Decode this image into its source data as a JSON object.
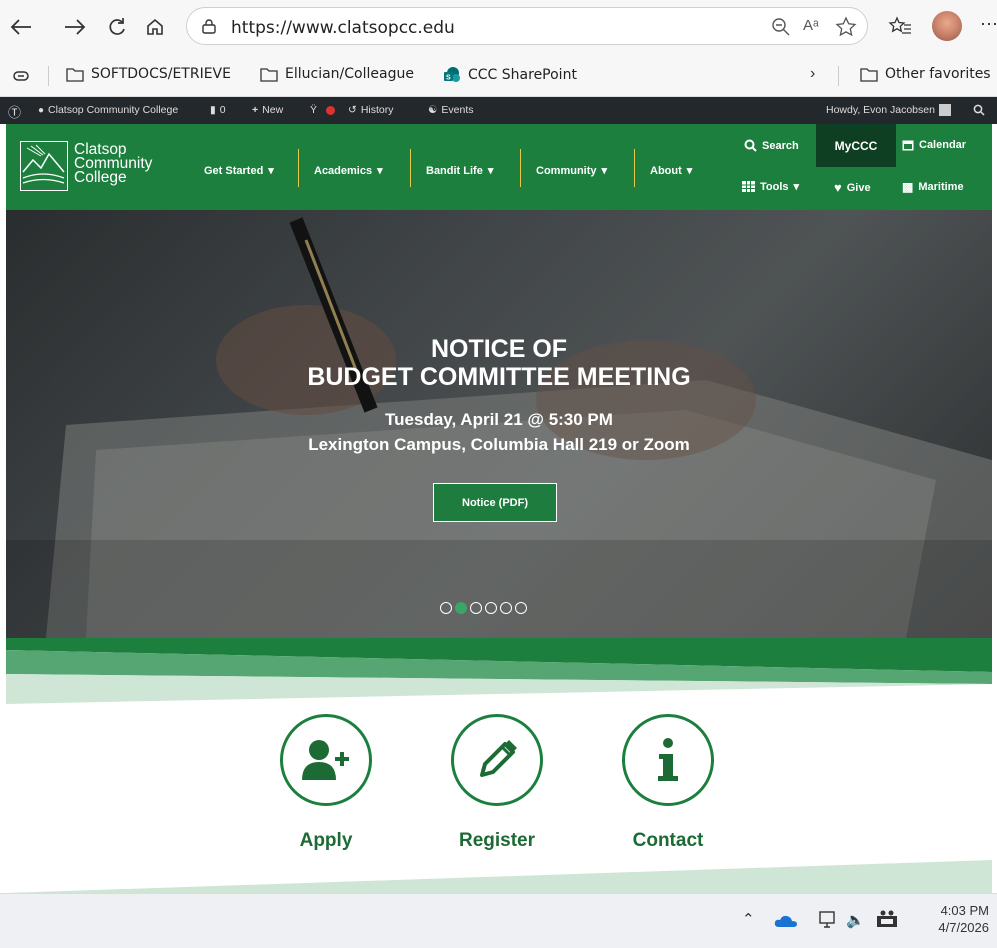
{
  "browser": {
    "url": "https://www.clatsopcc.edu",
    "bookmarks": [
      "SOFTDOCS/ETRIEVE",
      "Ellucian/Colleague",
      "CCC SharePoint"
    ],
    "other_favorites": "Other favorites"
  },
  "adminbar": {
    "site_name": "Clatsop Community College",
    "comments": "0",
    "new_label": "New",
    "history_label": "History",
    "events_label": "Events",
    "howdy": "Howdy, Evon Jacobsen"
  },
  "header": {
    "logo_lines": [
      "Clatsop",
      "Community",
      "College"
    ],
    "menu": [
      "Get Started",
      "Academics",
      "Bandit Life",
      "Community",
      "About"
    ],
    "search_label": "Search",
    "myccc_label": "MyCCC",
    "calendar_label": "Calendar",
    "tools_label": "Tools",
    "give_label": "Give",
    "maritime_label": "Maritime"
  },
  "hero": {
    "title_line1": "NOTICE OF",
    "title_line2": "BUDGET COMMITTEE MEETING",
    "sub_line1": "Tuesday, April 21 @ 5:30 PM",
    "sub_line2": "Lexington Campus, Columbia Hall 219 or Zoom",
    "button_label": "Notice (PDF)",
    "slide_count": 6,
    "active_slide": 2
  },
  "quick_links": [
    {
      "label": "Apply"
    },
    {
      "label": "Register"
    },
    {
      "label": "Contact"
    }
  ],
  "taskbar": {
    "time": "4:03 PM",
    "date": "4/7/2026"
  },
  "colors": {
    "brand_green": "#1d7f3e",
    "dark_green": "#0f3f22",
    "admin_bar": "#23282d"
  }
}
